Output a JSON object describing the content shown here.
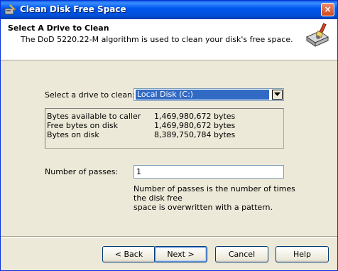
{
  "window": {
    "title": "Clean Disk Free Space",
    "close_label": "×"
  },
  "header": {
    "title": "Select A Drive to Clean",
    "description": "The DoD 5220.22-M algorithm is used to clean your disk's free space."
  },
  "drive": {
    "label": "Select a drive to clean:",
    "selected": "Local Disk (C:)"
  },
  "disk_info": [
    {
      "label": "Bytes available to caller",
      "value": "1,469,980,672 bytes"
    },
    {
      "label": "Free bytes on disk",
      "value": "1,469,980,672 bytes"
    },
    {
      "label": "Bytes on disk",
      "value": "8,389,750,784 bytes"
    }
  ],
  "passes": {
    "label": "Number of passes:",
    "value": "1",
    "help_line1": "Number of passes is the number of times the disk free",
    "help_line2": "space is overwritten with a pattern."
  },
  "buttons": {
    "back": "< Back",
    "next": "Next >",
    "cancel": "Cancel",
    "help": "Help"
  },
  "colors": {
    "titlebar": "#0058ee",
    "selection": "#316ac5",
    "dialog_bg": "#ece9d8"
  }
}
